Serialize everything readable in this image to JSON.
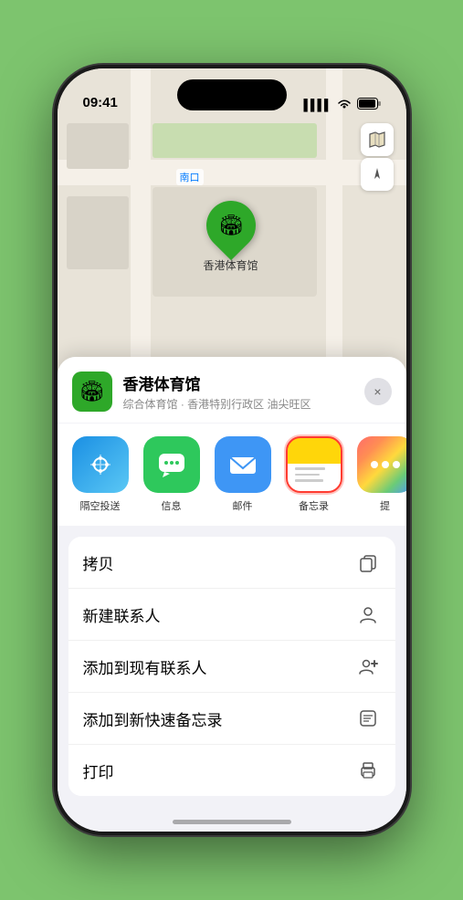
{
  "status_bar": {
    "time": "09:41",
    "signal": "●●●●",
    "wifi": "WiFi",
    "battery": "Battery"
  },
  "map": {
    "south_gate_label": "南口",
    "pin_label": "香港体育馆",
    "controls": {
      "map_type": "🗺",
      "location": "➤"
    }
  },
  "sheet": {
    "venue_name": "香港体育馆",
    "venue_subtitle": "综合体育馆 · 香港特别行政区 油尖旺区",
    "close_label": "×"
  },
  "share_items": [
    {
      "id": "airdrop",
      "label": "隔空投送",
      "type": "airdrop"
    },
    {
      "id": "messages",
      "label": "信息",
      "type": "messages"
    },
    {
      "id": "mail",
      "label": "邮件",
      "type": "mail"
    },
    {
      "id": "notes",
      "label": "备忘录",
      "type": "notes",
      "selected": true
    },
    {
      "id": "more",
      "label": "提",
      "type": "more"
    }
  ],
  "action_items": [
    {
      "id": "copy",
      "label": "拷贝",
      "icon": "copy"
    },
    {
      "id": "new-contact",
      "label": "新建联系人",
      "icon": "person"
    },
    {
      "id": "add-to-contact",
      "label": "添加到现有联系人",
      "icon": "person-add"
    },
    {
      "id": "add-to-notes",
      "label": "添加到新快速备忘录",
      "icon": "memo"
    },
    {
      "id": "print",
      "label": "打印",
      "icon": "print"
    }
  ]
}
